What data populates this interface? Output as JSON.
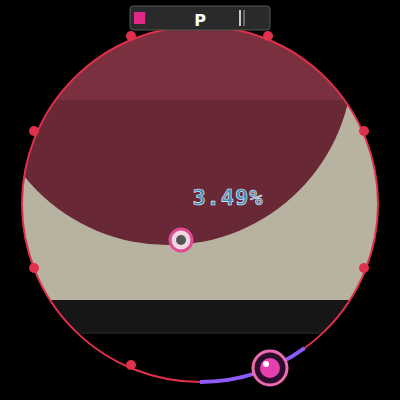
{
  "hud": {
    "label": "P",
    "level": 0.1
  },
  "accuracy": "3.49%",
  "ring": {
    "level": 0.1
  }
}
